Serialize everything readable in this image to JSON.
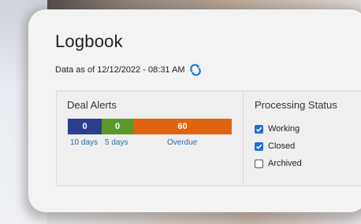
{
  "logbook": {
    "title": "Logbook",
    "as_of": "Data as of 12/12/2022 - 08:31 AM",
    "refresh_icon": "refresh-icon"
  },
  "deal_alerts": {
    "title": "Deal Alerts",
    "segments": [
      {
        "value": "0",
        "label": "10 days",
        "color": "#2a3f8f"
      },
      {
        "value": "0",
        "label": "5 days",
        "color": "#5a9a2a"
      },
      {
        "value": "60",
        "label": "Overdue",
        "color": "#e0640f"
      }
    ]
  },
  "processing_status": {
    "title": "Processing Status",
    "options": [
      {
        "label": "Working",
        "checked": true
      },
      {
        "label": "Closed",
        "checked": true
      },
      {
        "label": "Archived",
        "checked": false
      }
    ]
  }
}
